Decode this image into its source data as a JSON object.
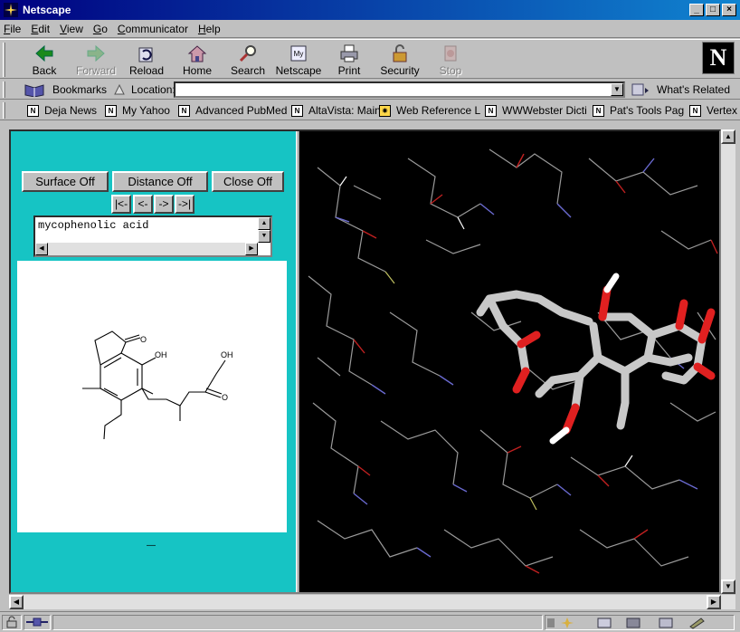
{
  "window": {
    "title": "Netscape"
  },
  "menu": [
    "File",
    "Edit",
    "View",
    "Go",
    "Communicator",
    "Help"
  ],
  "toolbar": {
    "back": "Back",
    "forward": "Forward",
    "reload": "Reload",
    "home": "Home",
    "search": "Search",
    "netscape": "Netscape",
    "print": "Print",
    "security": "Security",
    "stop": "Stop"
  },
  "location": {
    "bookmarks": "Bookmarks",
    "label": "Location:",
    "url": "",
    "whats_related": "What's Related"
  },
  "bookmarks": [
    "Deja News",
    "My Yahoo",
    "Advanced PubMed",
    "AltaVista: Main",
    "Web Reference L",
    "WWWebster Dicti",
    "Pat's Tools Pag",
    "Vertex"
  ],
  "viewer": {
    "surface_btn": "Surface Off",
    "distance_btn": "Distance Off",
    "close_btn": "Close Off",
    "nav_first": "|<-",
    "nav_prev": "<-",
    "nav_next": "->",
    "nav_last": "->|",
    "compound_name": "mycophenolic acid",
    "structure_labels": {
      "carbonyl_o": "O",
      "hydroxyl": "OH",
      "acid_oh": "OH",
      "acid_o": "O"
    },
    "footer_mark": "—"
  },
  "colors": {
    "frame_bg": "#16c4c4",
    "molecule_bg": "#000000",
    "titlebar": "#000080"
  }
}
